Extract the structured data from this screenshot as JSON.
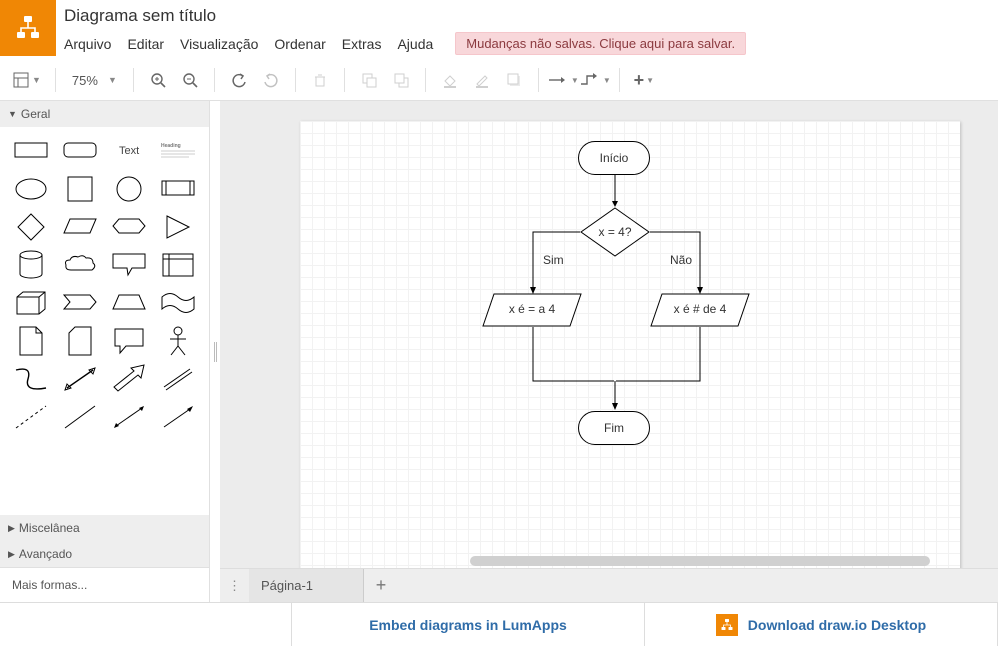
{
  "header": {
    "title": "Diagrama sem título",
    "menu": {
      "file": "Arquivo",
      "edit": "Editar",
      "view": "Visualização",
      "arrange": "Ordenar",
      "extras": "Extras",
      "help": "Ajuda"
    },
    "save_notice": "Mudanças não salvas. Clique aqui para salvar."
  },
  "toolbar": {
    "zoom": "75%"
  },
  "sidebar": {
    "sections": {
      "general": "Geral",
      "misc": "Miscelânea",
      "advanced": "Avançado"
    },
    "text_shape_label": "Text",
    "heading_shape_label": "Heading",
    "more_shapes": "Mais formas..."
  },
  "pages": {
    "page1": "Página-1"
  },
  "footer": {
    "embed": "Embed diagrams in LumApps",
    "download": "Download draw.io Desktop"
  },
  "flowchart": {
    "start": "Início",
    "decision": "x = 4?",
    "yes_label": "Sim",
    "no_label": "Não",
    "left_process": "x é = a 4",
    "right_process": "x é # de 4",
    "end": "Fim"
  }
}
